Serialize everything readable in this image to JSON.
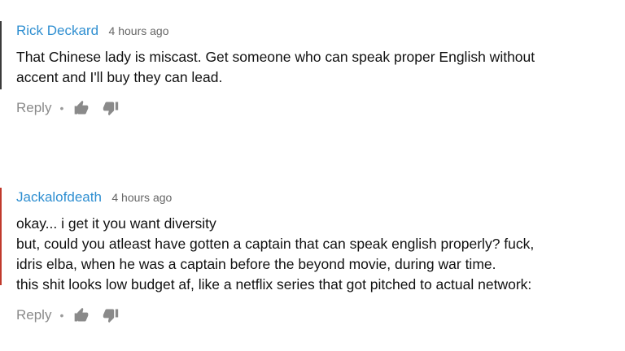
{
  "comments": [
    {
      "author": "Rick Deckard",
      "time": "4 hours ago",
      "lines": [
        "That Chinese lady is miscast. Get someone who can speak proper English without",
        "accent and I'll buy they can lead."
      ],
      "reply_label": "Reply",
      "separator": "•"
    },
    {
      "author": "Jackalofdeath",
      "time": "4 hours ago",
      "lines": [
        "okay... i get it you want diversity",
        "but, could you atleast have gotten a captain that can speak english properly?  fuck,",
        "idris elba, when he was a captain before the beyond movie, during war time.",
        "this shit looks low budget af, like a netflix series that got pitched to actual network:"
      ],
      "reply_label": "Reply",
      "separator": "•"
    }
  ],
  "icons": {
    "like": "thumbs-up-icon",
    "dislike": "thumbs-down-icon"
  },
  "colors": {
    "author": "#2f8fd1",
    "accent_bar_1": "#3a3a3a",
    "accent_bar_2": "#c0392b",
    "muted": "#8a8a8a"
  }
}
